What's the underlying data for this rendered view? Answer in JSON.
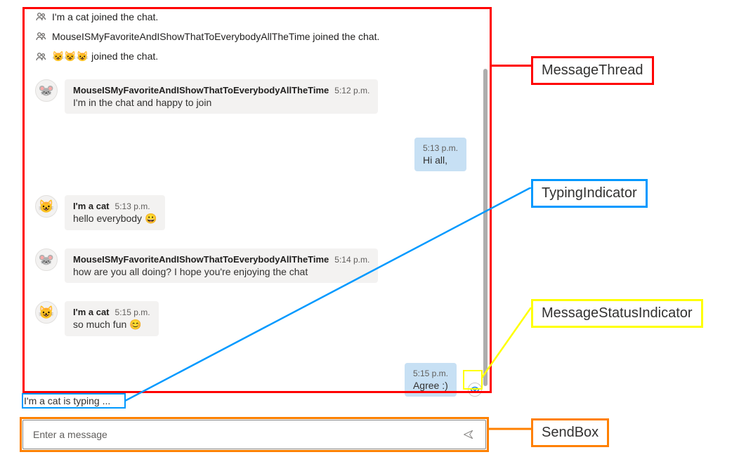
{
  "callouts": {
    "messageThread": "MessageThread",
    "typingIndicator": "TypingIndicator",
    "messageStatusIndicator": "MessageStatusIndicator",
    "sendBox": "SendBox"
  },
  "colors": {
    "red": "#ff0000",
    "blue": "#0099ff",
    "yellow": "#ffff00",
    "orange": "#ff8000",
    "otherBubble": "#f3f2f1",
    "mineBubble": "#c7e0f4"
  },
  "systemMessages": [
    {
      "text": "I'm a cat joined the chat."
    },
    {
      "text": "MouseISMyFavoriteAndIShowThatToEverybodyAllTheTime joined the chat."
    },
    {
      "text": "😺😺😺 joined the chat."
    }
  ],
  "messages": [
    {
      "type": "other",
      "avatar": "🐭",
      "name": "MouseISMyFavoriteAndIShowThatToEverybodyAllTheTime",
      "time": "5:12 p.m.",
      "content": "I'm in the chat and happy to join"
    },
    {
      "type": "mine",
      "time": "5:13 p.m.",
      "content": "Hi all,"
    },
    {
      "type": "other",
      "avatar": "😺",
      "name": "I'm a cat",
      "time": "5:13 p.m.",
      "content": "hello everybody 😀"
    },
    {
      "type": "other",
      "avatar": "🐭",
      "name": "MouseISMyFavoriteAndIShowThatToEverybodyAllTheTime",
      "time": "5:14 p.m.",
      "content": "how are you all doing? I hope you're enjoying the chat"
    },
    {
      "type": "other",
      "avatar": "😺",
      "name": "I'm a cat",
      "time": "5:15 p.m.",
      "content": "so much fun 😊"
    },
    {
      "type": "mine",
      "time": "5:15 p.m.",
      "content": "Agree :)",
      "status": "seen"
    }
  ],
  "typing": {
    "text": "I'm a cat is typing ..."
  },
  "sendBox": {
    "placeholder": "Enter a message"
  }
}
